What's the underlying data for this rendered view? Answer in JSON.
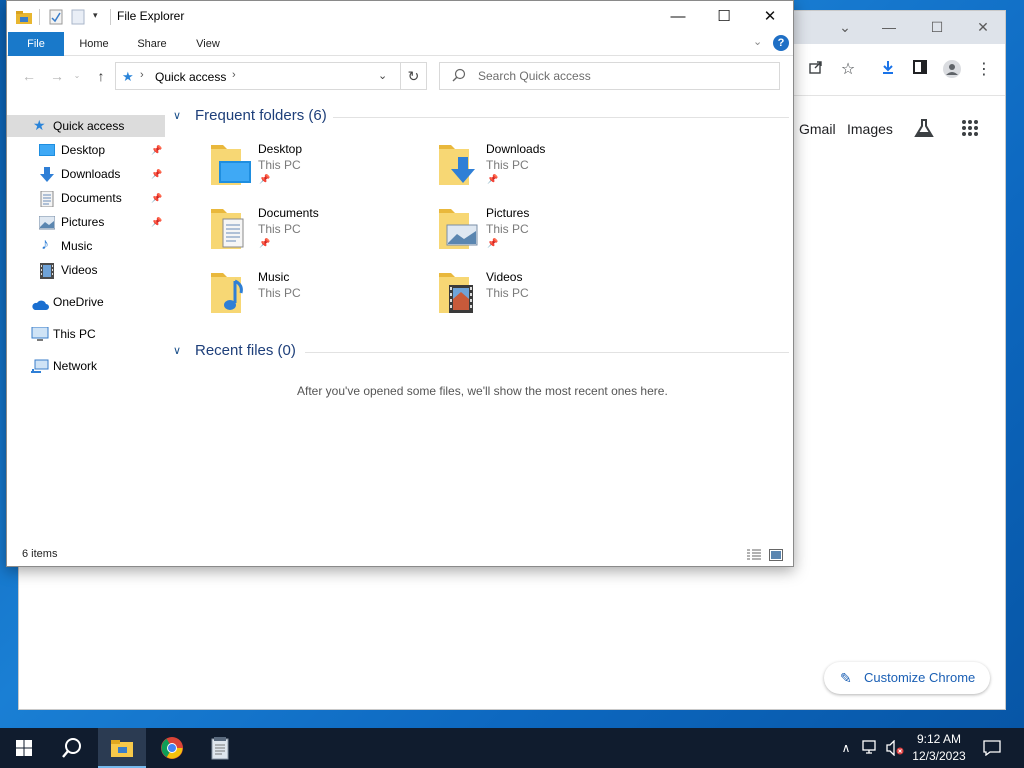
{
  "explorer": {
    "title": "File Explorer",
    "tabs": [
      {
        "label": "File"
      },
      {
        "label": "Home"
      },
      {
        "label": "Share"
      },
      {
        "label": "View"
      }
    ],
    "help_label": "?",
    "address": {
      "crumb": "Quick access"
    },
    "search": {
      "placeholder": "Search Quick access"
    },
    "sidebar": [
      {
        "label": "Quick access",
        "icon": "star-icon"
      },
      {
        "label": "Desktop",
        "icon": "desktop-icon"
      },
      {
        "label": "Downloads",
        "icon": "download-icon"
      },
      {
        "label": "Documents",
        "icon": "document-icon"
      },
      {
        "label": "Pictures",
        "icon": "pictures-icon"
      },
      {
        "label": "Music",
        "icon": "music-icon"
      },
      {
        "label": "Videos",
        "icon": "video-icon"
      },
      {
        "label": "OneDrive",
        "icon": "cloud-icon"
      },
      {
        "label": "This PC",
        "icon": "computer-icon"
      },
      {
        "label": "Network",
        "icon": "network-icon"
      }
    ],
    "frequent": {
      "title": "Frequent folders (6)",
      "folders": [
        {
          "name": "Desktop",
          "location": "This PC"
        },
        {
          "name": "Downloads",
          "location": "This PC"
        },
        {
          "name": "Documents",
          "location": "This PC"
        },
        {
          "name": "Pictures",
          "location": "This PC"
        },
        {
          "name": "Music",
          "location": "This PC"
        },
        {
          "name": "Videos",
          "location": "This PC"
        }
      ]
    },
    "recent": {
      "title": "Recent files (0)",
      "empty_message": "After you've opened some files, we'll show the most recent ones here."
    },
    "status": {
      "item_count": "6 items"
    }
  },
  "chrome": {
    "links": {
      "gmail": "Gmail",
      "images": "Images"
    },
    "customize_label": "Customize Chrome"
  },
  "taskbar": {
    "time": "9:12 AM",
    "date": "12/3/2023"
  },
  "colors": {
    "accent": "#1979ca",
    "folder_yellow": "#f7d774",
    "taskbar": "#101c2e"
  }
}
